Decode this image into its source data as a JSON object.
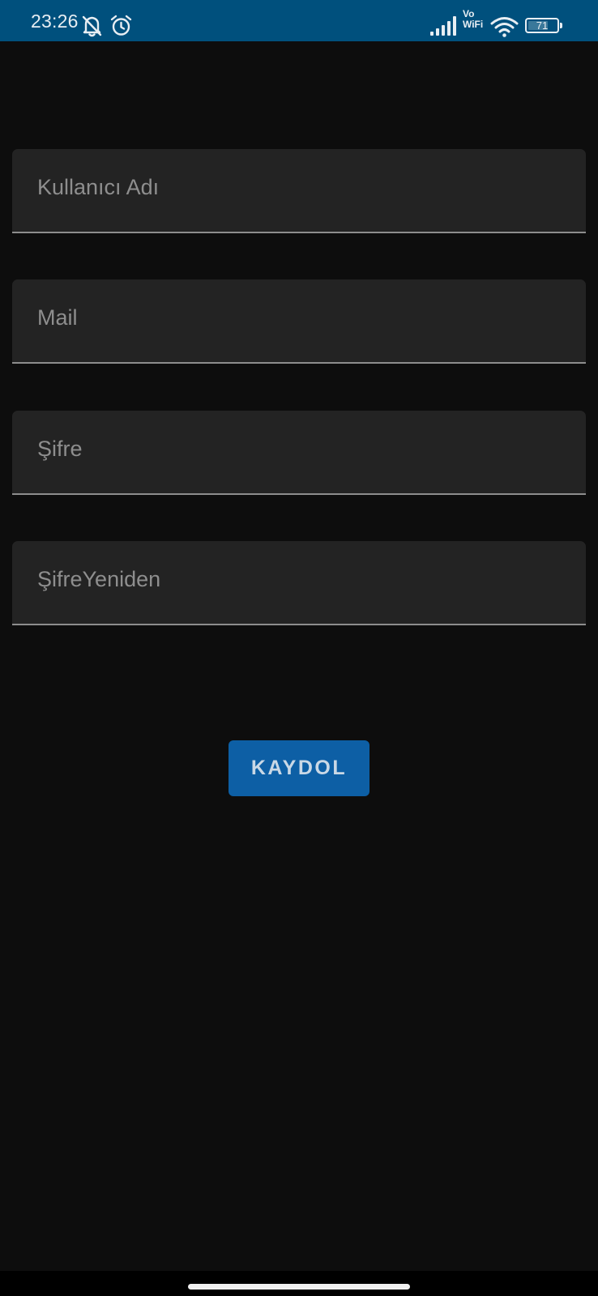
{
  "status_bar": {
    "time": "23:26",
    "vowifi_top": "Vo",
    "vowifi_bottom": "WiFi",
    "battery_level": "71",
    "battery_fraction": 0.71,
    "icons": [
      "bell-off-icon",
      "alarm-clock-icon",
      "signal-strength-icon",
      "wifi-icon",
      "battery-icon"
    ]
  },
  "form": {
    "username_placeholder": "Kullanıcı Adı",
    "email_placeholder": "Mail",
    "password_placeholder": "Şifre",
    "password_confirm_placeholder": "ŞifreYeniden",
    "register_label": "KAYDOL"
  },
  "colors": {
    "status_bar": "#00507d",
    "background": "#0d0d0d",
    "field_background": "#232323",
    "field_underline": "#8d8d8d",
    "button": "#0d5fa5",
    "button_text": "#c9d8e6"
  }
}
